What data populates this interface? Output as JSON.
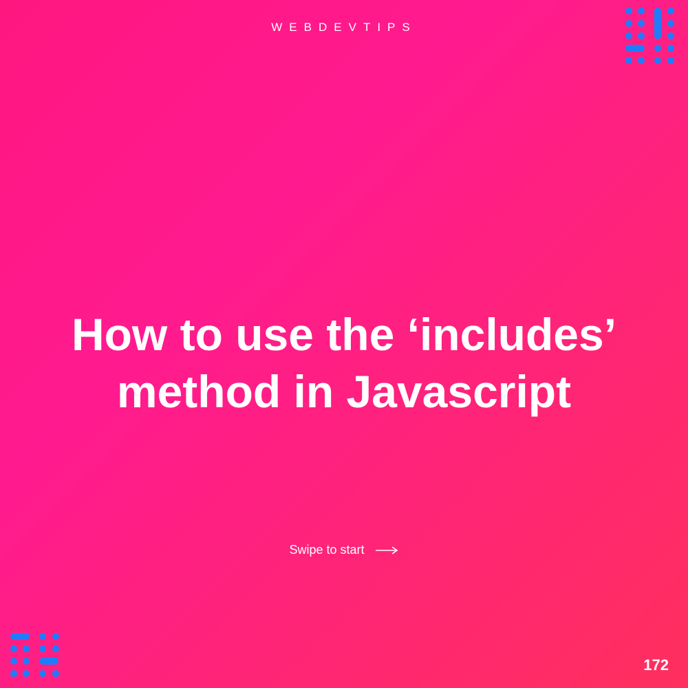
{
  "header": {
    "brand": "WEBDEVTIPS"
  },
  "main": {
    "title": "How to use the ‘includes’ method in Javascript"
  },
  "footer": {
    "swipe_label": "Swipe to start",
    "page_number": "172"
  },
  "colors": {
    "accent": "#1E7DFF"
  }
}
